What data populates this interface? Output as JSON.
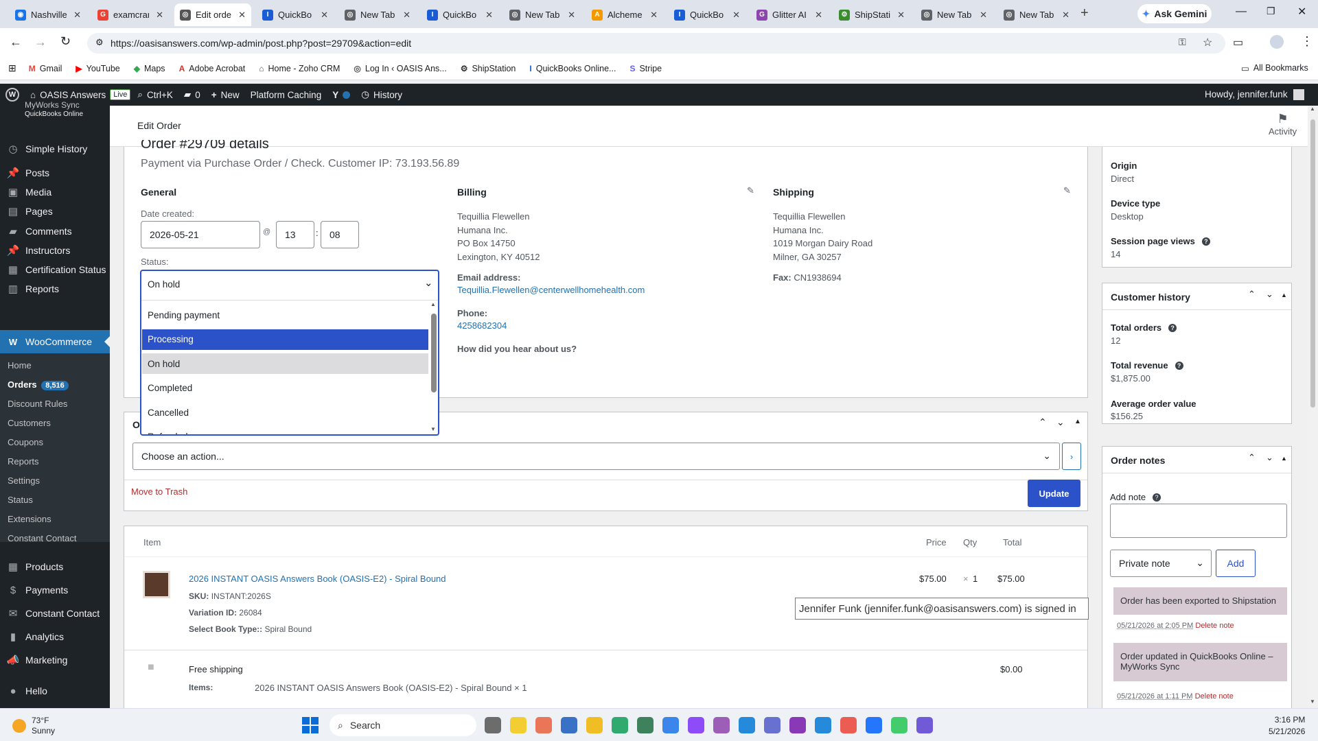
{
  "browser": {
    "tabs": [
      {
        "title": "Nashville",
        "color": "#1a73e8",
        "letter": "◉"
      },
      {
        "title": "examcram",
        "color": "#ea4335",
        "letter": "G"
      },
      {
        "title": "Edit orde",
        "color": "#555",
        "letter": "◎"
      },
      {
        "title": "QuickBo",
        "color": "#1a5bd6",
        "letter": "I"
      },
      {
        "title": "New Tab",
        "color": "#5f6368",
        "letter": "◎"
      },
      {
        "title": "QuickBo",
        "color": "#1a5bd6",
        "letter": "I"
      },
      {
        "title": "New Tab",
        "color": "#5f6368",
        "letter": "◎"
      },
      {
        "title": "Alcheme",
        "color": "#f29900",
        "letter": "A"
      },
      {
        "title": "QuickBo",
        "color": "#1a5bd6",
        "letter": "I"
      },
      {
        "title": "Glitter AI",
        "color": "#8e44ad",
        "letter": "G"
      },
      {
        "title": "ShipStati",
        "color": "#3a8d2f",
        "letter": "⚙"
      },
      {
        "title": "New Tab",
        "color": "#5f6368",
        "letter": "◎"
      },
      {
        "title": "New Tab",
        "color": "#5f6368",
        "letter": "◎"
      }
    ],
    "ask_gemini": "Ask Gemini",
    "url": "https://oasisanswers.com/wp-admin/post.php?post=29709&action=edit",
    "bookmarks": [
      "Gmail",
      "YouTube",
      "Maps",
      "Adobe Acrobat",
      "Home - Zoho CRM",
      "Log In ‹ OASIS Ans...",
      "ShipStation",
      "QuickBooks Online...",
      "Stripe"
    ],
    "all_bookmarks": "All Bookmarks"
  },
  "adminbar": {
    "site": "OASIS Answers",
    "live": "Live",
    "search": "Ctrl+K",
    "comments": "0",
    "new": "New",
    "caching": "Platform Caching",
    "history": "History",
    "howdy": "Howdy, jennifer.funk"
  },
  "sidebar": {
    "top_label": "MyWorks Sync",
    "top_sub": "QuickBooks Online",
    "items": [
      "Simple History",
      "Posts",
      "Media",
      "Pages",
      "Comments",
      "Instructors",
      "Certification Status",
      "Reports"
    ],
    "woo": "WooCommerce",
    "woo_sub": [
      "Home",
      "Orders",
      "Discount Rules",
      "Customers",
      "Coupons",
      "Reports",
      "Settings",
      "Status",
      "Extensions",
      "Constant Contact"
    ],
    "orders_badge": "8,516",
    "items2": [
      "Products",
      "Payments",
      "Constant Contact",
      "Analytics",
      "Marketing",
      "Hello"
    ]
  },
  "header": {
    "title": "Edit Order",
    "activity": "Activity"
  },
  "order": {
    "title": "Order #29709 details",
    "subtitle": "Payment via Purchase Order / Check. Customer IP: 73.193.56.89",
    "general": "General",
    "date_label": "Date created:",
    "date": "2026-05-21",
    "at": "@",
    "hour": "13",
    "colon": ":",
    "minute": "08",
    "status_label": "Status:",
    "status": "On hold",
    "options": [
      "Pending payment",
      "Processing",
      "On hold",
      "Completed",
      "Cancelled",
      "Refunded"
    ],
    "billing": {
      "heading": "Billing",
      "lines": [
        "Tequillia Flewellen",
        "Humana Inc.",
        "PO Box 14750",
        "Lexington, KY 40512"
      ],
      "email_label": "Email address:",
      "email": "Tequillia.Flewellen@centerwellhomehealth.com",
      "phone_label": "Phone:",
      "phone": "4258682304",
      "hear": "How did you hear about us?"
    },
    "shipping": {
      "heading": "Shipping",
      "lines": [
        "Tequillia Flewellen",
        "Humana Inc.",
        "1019 Morgan Dairy Road",
        "Milner, GA 30257"
      ],
      "fax_label": "Fax:",
      "fax": "CN1938694"
    }
  },
  "actions": {
    "heading_initial": "O",
    "choose": "Choose an action...",
    "trash": "Move to Trash",
    "update": "Update"
  },
  "items": {
    "head": {
      "item": "Item",
      "price": "Price",
      "qty": "Qty",
      "total": "Total"
    },
    "product": {
      "name": "2026 INSTANT OASIS Answers Book (OASIS-E2) - Spiral Bound",
      "sku_label": "SKU:",
      "sku": "INSTANT:2026S",
      "var_label": "Variation ID:",
      "var": "26084",
      "type_label": "Select Book Type::",
      "type": "Spiral Bound",
      "price": "$75.00",
      "qty_x": "×",
      "qty": "1",
      "total": "$75.00"
    },
    "shipping": {
      "name": "Free shipping",
      "items_label": "Items:",
      "items": "2026 INSTANT OASIS Answers Book (OASIS-E2) - Spiral Bound × 1",
      "total": "$0.00"
    },
    "tooltip": "Jennifer Funk (jennifer.funk@oasisanswers.com) is signed in"
  },
  "right": {
    "origin_label": "Origin",
    "origin": "Direct",
    "device_label": "Device type",
    "device": "Desktop",
    "views_label": "Session page views",
    "views": "14",
    "history_title": "Customer history",
    "total_orders_label": "Total orders",
    "total_orders": "12",
    "revenue_label": "Total revenue",
    "revenue": "$1,875.00",
    "aov_label": "Average order value",
    "aov": "$156.25",
    "notes_title": "Order notes",
    "add_note_label": "Add note",
    "note_type": "Private note",
    "add_btn": "Add",
    "notes": [
      {
        "text": "Order has been exported to Shipstation",
        "date": "05/21/2026 at 2:05 PM",
        "delete": "Delete note"
      },
      {
        "text": "Order updated in QuickBooks Online – MyWorks Sync",
        "date": "05/21/2026 at 1:11 PM",
        "delete": "Delete note"
      }
    ]
  },
  "taskbar": {
    "temp": "73°F",
    "weather": "Sunny",
    "search": "Search",
    "time": "3:16 PM",
    "date": "5/21/2026"
  }
}
